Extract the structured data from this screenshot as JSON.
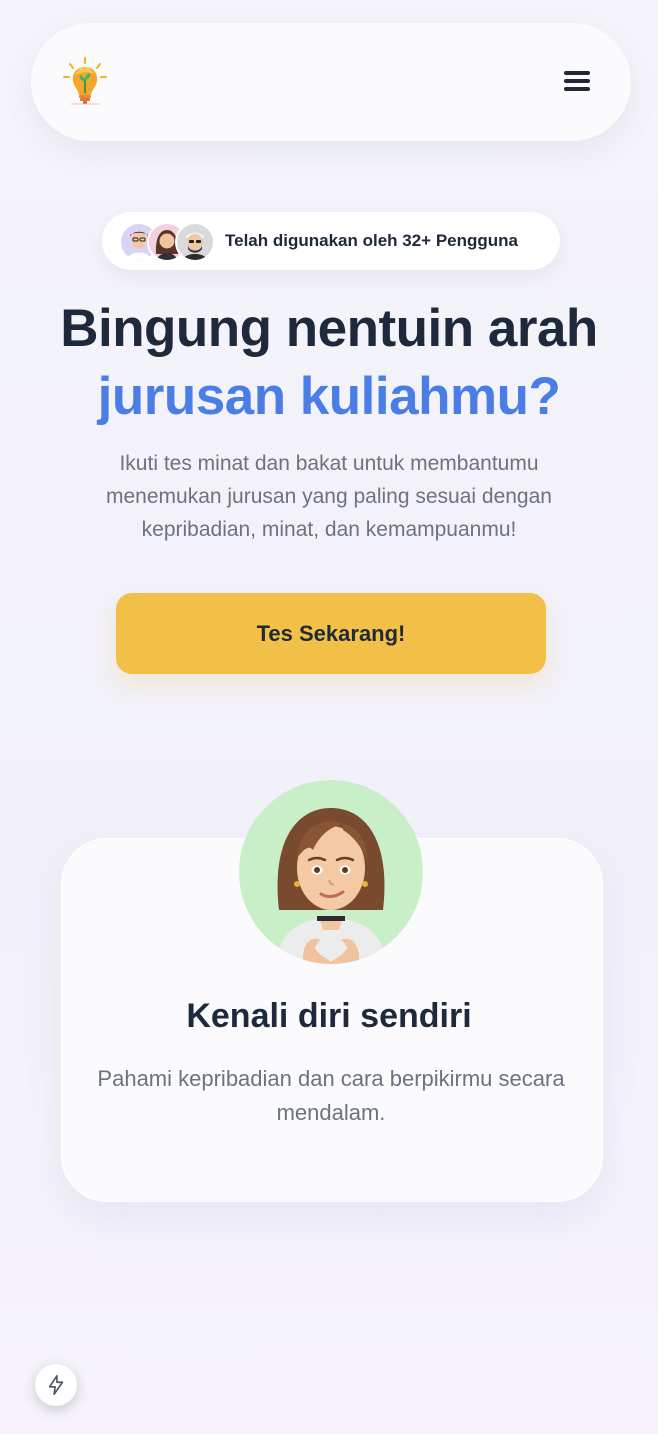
{
  "navbar": {
    "logo_icon": "lightbulb-plant-logo",
    "menu_icon": "hamburger-menu-icon"
  },
  "hero": {
    "users_badge": "Telah digunakan oleh 32+ Pengguna",
    "title_line1": "Bingung nentuin arah",
    "title_line2": "jurusan kuliahmu?",
    "description": "Ikuti tes minat dan bakat untuk membantumu menemukan jurusan yang paling sesuai dengan kepribadian, minat, dan kemampuanmu!",
    "cta_label": "Tes Sekarang!"
  },
  "feature_card": {
    "title": "Kenali diri sendiri",
    "description": "Pahami kepribadian dan cara berpikirmu secara mendalam."
  },
  "colors": {
    "accent_blue": "#4a7ee6",
    "cta_yellow": "#f2c046",
    "heading_dark": "#1e293b",
    "body_gray": "#6b7280",
    "avatar_bg_green": "#c9efc8"
  },
  "floating_button": {
    "icon": "lightning-bolt-icon"
  }
}
